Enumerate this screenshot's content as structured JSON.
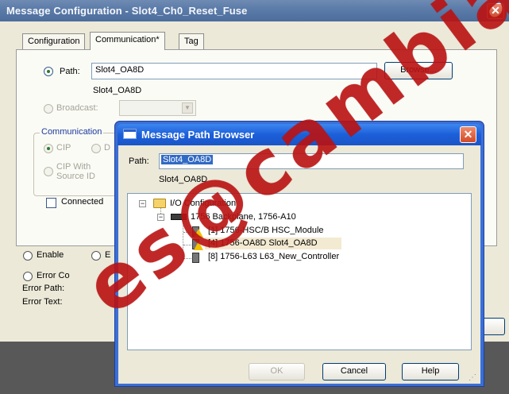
{
  "outer_window": {
    "title": "Message Configuration - Slot4_Ch0_Reset_Fuse",
    "close_glyph": "✕",
    "tabs": [
      "Configuration",
      "Communication*",
      "Tag"
    ],
    "path_label": "Path:",
    "path_value": "Slot4_OA8D",
    "path_resolved": "Slot4_OA8D",
    "browse_label": "Browse...",
    "broadcast_label": "Broadcast:",
    "communication_group_label": "Communication",
    "cip_label": "CIP",
    "d_label": "D",
    "cip_with_source_id_label_1": "CIP With",
    "cip_with_source_id_label_2": "Source ID",
    "connected_label": "Connected",
    "enable_label": "Enable",
    "e_label": "E",
    "error_code_label": "Error Co",
    "error_path_label": "Error Path:",
    "error_text_label": "Error Text:"
  },
  "path_browser": {
    "title": "Message Path Browser",
    "close_glyph": "✕",
    "path_label": "Path:",
    "path_value": "Slot4_OA8D",
    "path_resolved": "Slot4_OA8D",
    "tree": {
      "root": "I/O Configuration",
      "backplane": "1756 Backplane, 1756-A10",
      "modules": [
        "[1] 1756-HSC/B HSC_Module",
        "[4] 1756-OA8D Slot4_OA8D",
        "[8] 1756-L63 L63_New_Controller"
      ]
    },
    "ok_label": "OK",
    "cancel_label": "Cancel",
    "help_label": "Help"
  },
  "watermark": "es@cambia.c",
  "colors": {
    "outer_title_bar": "#5a7aa8",
    "modal_title_bar": "#1c5fd9",
    "dialog_face": "#ece9d8",
    "watermark": "#be1414",
    "selection_highlight": "#f3ead2"
  },
  "icons": [
    "close-icon",
    "dialog-icon",
    "folder-icon",
    "backplane-icon",
    "module-icon",
    "warning-icon",
    "resize-grip-icon"
  ]
}
